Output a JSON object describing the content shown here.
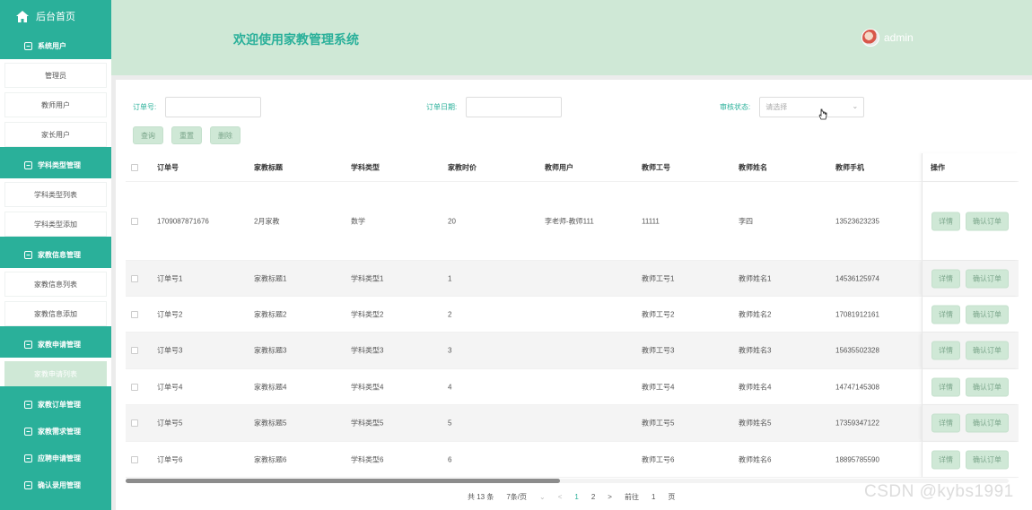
{
  "sidebar": {
    "home": "后台首页",
    "groups": [
      {
        "label": "系统用户",
        "items": [
          "管理员",
          "教师用户",
          "家长用户"
        ]
      },
      {
        "label": "学科类型管理",
        "items": [
          "学科类型列表",
          "学科类型添加"
        ]
      },
      {
        "label": "家教信息管理",
        "items": [
          "家教信息列表",
          "家教信息添加"
        ]
      },
      {
        "label": "家教申请管理",
        "items": [
          "家教申请列表"
        ]
      },
      {
        "label": "家教订单管理",
        "items": []
      },
      {
        "label": "家教需求管理",
        "items": []
      },
      {
        "label": "应聘申请管理",
        "items": []
      },
      {
        "label": "确认录用管理",
        "items": []
      }
    ]
  },
  "header": {
    "title": "欢迎使用家教管理系统",
    "user": "admin"
  },
  "search": {
    "order_no_label": "订单号:",
    "order_date_label": "订单日期:",
    "status_label": "审核状态:",
    "status_placeholder": "请选择"
  },
  "buttons": {
    "query": "查询",
    "reset": "重置",
    "delete": "删除"
  },
  "table": {
    "columns": [
      "订单号",
      "家教标题",
      "学科类型",
      "家教时价",
      "教师用户",
      "教师工号",
      "教师姓名",
      "教师手机",
      "操作"
    ],
    "rows": [
      [
        "1709087871676",
        "2月家教",
        "数学",
        "20",
        "李老师-教师111",
        "11111",
        "李四",
        "13523623235"
      ],
      [
        "订单号1",
        "家教标题1",
        "学科类型1",
        "1",
        "",
        "教师工号1",
        "教师姓名1",
        "14536125974"
      ],
      [
        "订单号2",
        "家教标题2",
        "学科类型2",
        "2",
        "",
        "教师工号2",
        "教师姓名2",
        "17081912161"
      ],
      [
        "订单号3",
        "家教标题3",
        "学科类型3",
        "3",
        "",
        "教师工号3",
        "教师姓名3",
        "15635502328"
      ],
      [
        "订单号4",
        "家教标题4",
        "学科类型4",
        "4",
        "",
        "教师工号4",
        "教师姓名4",
        "14747145308"
      ],
      [
        "订单号5",
        "家教标题5",
        "学科类型5",
        "5",
        "",
        "教师工号5",
        "教师姓名5",
        "17359347122"
      ],
      [
        "订单号6",
        "家教标题6",
        "学科类型6",
        "6",
        "",
        "教师工号6",
        "教师姓名6",
        "18895785590"
      ]
    ],
    "row_actions": {
      "detail": "详情",
      "confirm": "确认订单"
    }
  },
  "pager": {
    "total": "共 13 条",
    "page_size": "7条/页",
    "pages": [
      "1",
      "2"
    ],
    "current": "1",
    "goto_label": "前往",
    "goto_value": "1",
    "goto_suffix": "页"
  },
  "watermark": "CSDN @kybs1991",
  "colors": {
    "primary": "#2ab09a",
    "light": "#cfe8d6"
  }
}
